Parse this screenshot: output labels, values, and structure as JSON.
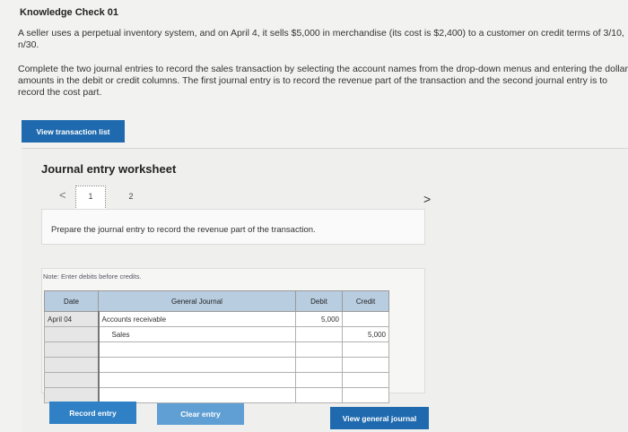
{
  "title": "Knowledge Check 01",
  "paragraphs": {
    "p1": "A seller uses a perpetual inventory system, and on April 4, it sells $5,000 in merchandise (its cost is $2,400) to a customer on credit terms of 3/10, n/30.",
    "p2": "Complete the two journal entries to record the sales transaction by selecting the account names from the drop-down menus and entering the dollar amounts in the debit or credit columns. The first journal entry is to record the revenue part of the transaction and the second journal entry is to record the cost part."
  },
  "buttons": {
    "view_transaction_list": "View transaction list",
    "record_entry": "Record entry",
    "clear_entry": "Clear entry",
    "view_general_journal": "View general journal"
  },
  "worksheet": {
    "title": "Journal entry worksheet",
    "prev": "<",
    "next": ">",
    "pages": [
      "1",
      "2"
    ],
    "instruction": "Prepare the journal entry to record the revenue part of the transaction.",
    "note": "Note: Enter debits before credits."
  },
  "journal": {
    "headers": {
      "date": "Date",
      "general": "General Journal",
      "debit": "Debit",
      "credit": "Credit"
    },
    "rows": [
      {
        "date": "April 04",
        "account": "Accounts receivable",
        "debit": "5,000",
        "credit": ""
      },
      {
        "date": "",
        "account": "Sales",
        "debit": "",
        "credit": "5,000"
      },
      {
        "date": "",
        "account": "",
        "debit": "",
        "credit": ""
      },
      {
        "date": "",
        "account": "",
        "debit": "",
        "credit": ""
      },
      {
        "date": "",
        "account": "",
        "debit": "",
        "credit": ""
      },
      {
        "date": "",
        "account": "",
        "debit": "",
        "credit": ""
      }
    ]
  },
  "colors": {
    "button_primary": "#1f6aaf",
    "button_light": "#5f9fd4",
    "table_header": "#b9cde1"
  }
}
